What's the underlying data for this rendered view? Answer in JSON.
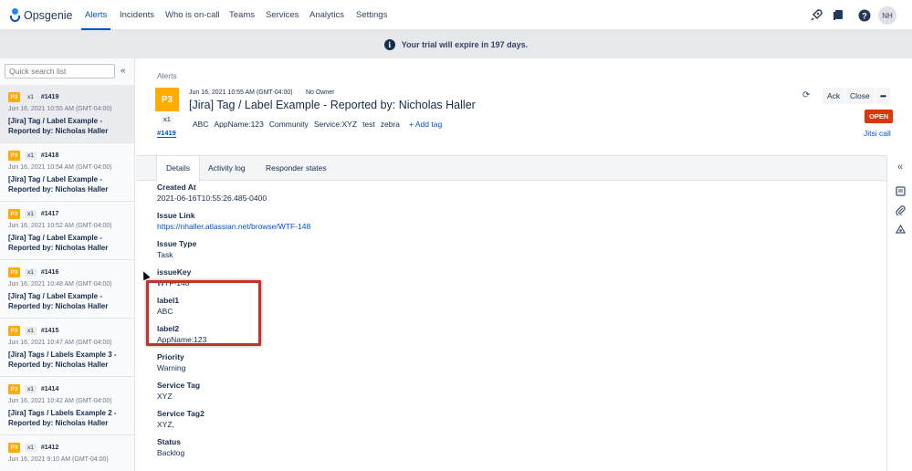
{
  "app": {
    "name": "Opsgenie",
    "nav": [
      {
        "label": "Alerts",
        "active": true
      },
      {
        "label": "Incidents"
      },
      {
        "label": "Who is on-call"
      },
      {
        "label": "Teams"
      },
      {
        "label": "Services"
      },
      {
        "label": "Analytics"
      },
      {
        "label": "Settings"
      }
    ],
    "top_icons": [
      "rocket-icon",
      "book-icon",
      "help-icon"
    ],
    "avatar_initials": "NH"
  },
  "banner": {
    "text": "Your trial will expire in 197 days."
  },
  "sidebar": {
    "search_placeholder": "Quick search list",
    "items": [
      {
        "priority": "P3",
        "count": "x1",
        "number": "#1419",
        "date": "Jun 16, 2021 10:55 AM (GMT-04:00)",
        "title": "[Jira] Tag / Label Example - Reported by: Nicholas Haller"
      },
      {
        "priority": "P3",
        "count": "x1",
        "number": "#1418",
        "date": "Jun 16, 2021 10:54 AM (GMT-04:00)",
        "title": "[Jira] Tag / Label Example - Reported by: Nicholas Haller"
      },
      {
        "priority": "P3",
        "count": "x1",
        "number": "#1417",
        "date": "Jun 16, 2021 10:52 AM (GMT-04:00)",
        "title": "[Jira] Tag / Label Example - Reported by: Nicholas Haller"
      },
      {
        "priority": "P3",
        "count": "x1",
        "number": "#1416",
        "date": "Jun 16, 2021 10:48 AM (GMT-04:00)",
        "title": "[Jira] Tag / Label Example - Reported by: Nicholas Haller"
      },
      {
        "priority": "P3",
        "count": "x1",
        "number": "#1415",
        "date": "Jun 16, 2021 10:47 AM (GMT-04:00)",
        "title": "[Jira] Tags / Labels Example 3 - Reported by: Nicholas Haller"
      },
      {
        "priority": "P3",
        "count": "x1",
        "number": "#1414",
        "date": "Jun 16, 2021 10:42 AM (GMT-04:00)",
        "title": "[Jira] Tags / Labels Example 2 - Reported by: Nicholas Haller"
      },
      {
        "priority": "P3",
        "count": "x1",
        "number": "#1412",
        "date": "Jun 16, 2021 9:10 AM (GMT-04:00)",
        "title": ""
      }
    ]
  },
  "alert": {
    "breadcrumb": "Alerts",
    "priority": "P3",
    "count": "x1",
    "number": "#1419",
    "date": "Jun 16, 2021 10:55 AM (GMT-04:00)",
    "separator": "·",
    "owner": "No Owner",
    "title": "[Jira] Tag / Label Example - Reported by: Nicholas Haller",
    "tags": [
      "ABC",
      "AppName:123",
      "Community",
      "Service:XYZ",
      "test",
      "zebra"
    ],
    "add_tag": "+ Add tag",
    "actions": {
      "ack": "Ack",
      "close": "Close",
      "more": "•••"
    },
    "status": "OPEN",
    "jitsi": "Jitsi call"
  },
  "tabs": [
    {
      "label": "Details",
      "active": true
    },
    {
      "label": "Activity log"
    },
    {
      "label": "Responder states"
    }
  ],
  "details": [
    {
      "label": "Created At",
      "value": "2021-06-16T10:55:26.485-0400"
    },
    {
      "label": "Issue Link",
      "value": "https://nhaller.atlassian.net/browse/WTF-148",
      "link": true
    },
    {
      "label": "Issue Type",
      "value": "Task"
    },
    {
      "label": "issueKey",
      "value": "WTF-148"
    },
    {
      "label": "label1",
      "value": "ABC"
    },
    {
      "label": "label2",
      "value": "AppName:123"
    },
    {
      "label": "Priority",
      "value": "Warning"
    },
    {
      "label": "Service Tag",
      "value": "XYZ"
    },
    {
      "label": "Service Tag2",
      "value": "XYZ,"
    },
    {
      "label": "Status",
      "value": "Backlog"
    }
  ],
  "colors": {
    "accent": "#0052cc",
    "priority_p3": "#ffab00",
    "open": "#de350b",
    "highlight": "#c9302c"
  }
}
